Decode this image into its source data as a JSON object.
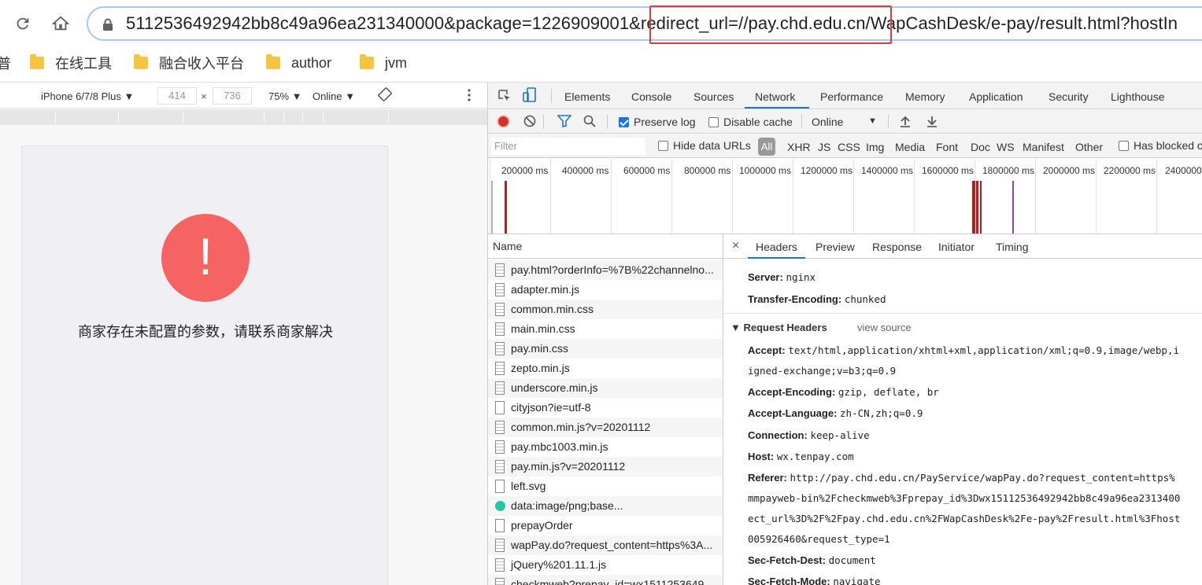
{
  "browser": {
    "url_text": "5112536492942bb8c49a96ea231340000&package=1226909001&redirect_url=//pay.chd.edu.cn/WapCashDesk/e-pay/result.html?hostIn",
    "reload_icon": "reload-icon",
    "home_icon": "home-icon"
  },
  "bookmarks": [
    {
      "label": "普"
    },
    {
      "label": "在线工具"
    },
    {
      "label": "融合收入平台"
    },
    {
      "label": "author"
    },
    {
      "label": "jvm"
    }
  ],
  "device_toolbar": {
    "device": "iPhone 6/7/8 Plus ▼",
    "width": "414",
    "times": "×",
    "height": "736",
    "zoom": "75% ▼",
    "throttle": "Online ▼"
  },
  "page": {
    "error_symbol": "!",
    "error_message": "商家存在未配置的参数，请联系商家解决"
  },
  "devtools": {
    "tabs": [
      "Elements",
      "Console",
      "Sources",
      "Network",
      "Performance",
      "Memory",
      "Application",
      "Security",
      "Lighthouse"
    ],
    "active_tab": "Network",
    "preserve_log": "Preserve log",
    "disable_cache": "Disable cache",
    "throttle": "Online",
    "filter_placeholder": "Filter",
    "hide_data_urls": "Hide data URLs",
    "all": "All",
    "types": [
      "XHR",
      "JS",
      "CSS",
      "Img",
      "Media",
      "Font",
      "Doc",
      "WS",
      "Manifest",
      "Other"
    ],
    "has_blocked": "Has blocked c",
    "timeline_labels": [
      "200000 ms",
      "400000 ms",
      "600000 ms",
      "800000 ms",
      "1000000 ms",
      "1200000 ms",
      "1400000 ms",
      "1600000 ms",
      "1800000 ms",
      "2000000 ms",
      "2200000 ms",
      "2400000"
    ],
    "name_header": "Name",
    "requests": [
      {
        "name": "pay.html?orderInfo=%7B%22channelno...",
        "icon": "doc"
      },
      {
        "name": "adapter.min.js",
        "icon": "doc"
      },
      {
        "name": "common.min.css",
        "icon": "doc"
      },
      {
        "name": "main.min.css",
        "icon": "doc"
      },
      {
        "name": "pay.min.css",
        "icon": "doc"
      },
      {
        "name": "zepto.min.js",
        "icon": "doc"
      },
      {
        "name": "underscore.min.js",
        "icon": "doc"
      },
      {
        "name": "cityjson?ie=utf-8",
        "icon": "file"
      },
      {
        "name": "common.min.js?v=20201112",
        "icon": "doc"
      },
      {
        "name": "pay.mbc1003.min.js",
        "icon": "doc"
      },
      {
        "name": "pay.min.js?v=20201112",
        "icon": "doc"
      },
      {
        "name": "left.svg",
        "icon": "file"
      },
      {
        "name": "data:image/png;base...",
        "icon": "img"
      },
      {
        "name": "prepayOrder",
        "icon": "file"
      },
      {
        "name": "wapPay.do?request_content=https%3A...",
        "icon": "doc"
      },
      {
        "name": "jQuery%201.11.1.js",
        "icon": "doc"
      },
      {
        "name": "checkmweb?prepay_id=wx1511253649",
        "icon": "doc"
      }
    ],
    "detail_tabs": [
      "Headers",
      "Preview",
      "Response",
      "Initiator",
      "Timing"
    ],
    "detail_active": "Headers",
    "close": "×",
    "response_headers": [
      {
        "k": "Server:",
        "v": "nginx"
      },
      {
        "k": "Transfer-Encoding:",
        "v": "chunked"
      }
    ],
    "request_headers_title": "▼ Request Headers",
    "view_source": "view source",
    "request_headers": {
      "accept_k": "Accept:",
      "accept_v": "text/html,application/xhtml+xml,application/xml;q=0.9,image/webp,i",
      "accept_cont": "igned-exchange;v=b3;q=0.9",
      "encoding_k": "Accept-Encoding:",
      "encoding_v": "gzip, deflate, br",
      "language_k": "Accept-Language:",
      "language_v": "zh-CN,zh;q=0.9",
      "connection_k": "Connection:",
      "connection_v": "keep-alive",
      "host_k": "Host:",
      "host_v": "wx.tenpay.com",
      "referer_k": "Referer:",
      "referer_v": "http://pay.chd.edu.cn/PayService/wapPay.do?request_content=https%",
      "referer_c1": "mmpayweb-bin%2Fcheckmweb%3Fprepay_id%3Dwx15112536492942bb8c49a96ea2313400",
      "referer_c2": "ect_url%3D%2F%2Fpay.chd.edu.cn%2FWapCashDesk%2Fe-pay%2Fresult.html%3Fhost",
      "referer_c3": "005926460&request_type=1",
      "dest_k": "Sec-Fetch-Dest:",
      "dest_v": "document",
      "mode_k": "Sec-Fetch-Mode:",
      "mode_v": "navigate"
    }
  },
  "colors": {
    "accent": "#1a73e8",
    "error": "#f56462",
    "highlight_box": "#e53935"
  }
}
